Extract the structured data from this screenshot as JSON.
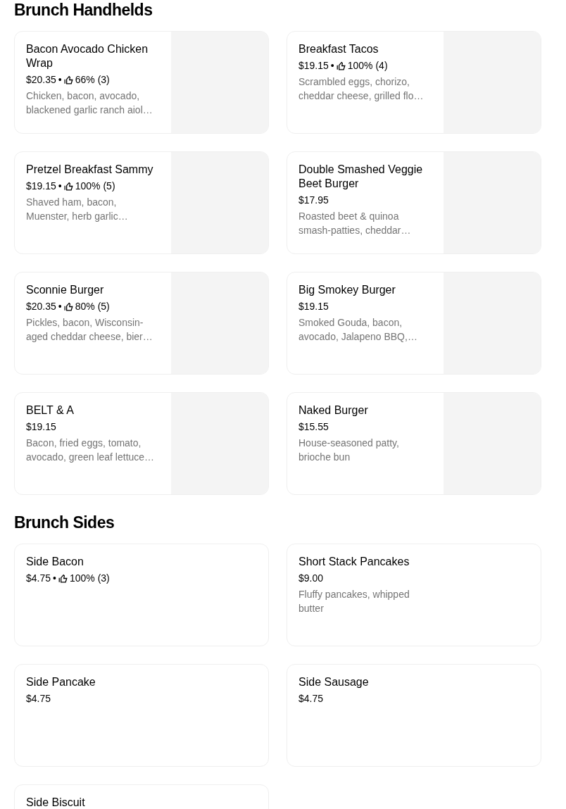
{
  "sections": [
    {
      "title": "Brunch Handhelds",
      "items": [
        {
          "name": "Bacon Avocado Chicken Wrap",
          "price": "$20.35",
          "separator": "•",
          "rating": "66% (3)",
          "description": "Chicken, bacon, avocado, blackened garlic ranch aiol…",
          "image": true
        },
        {
          "name": "Breakfast Tacos",
          "price": "$19.15",
          "separator": "•",
          "rating": "100% (4)",
          "description": "Scrambled eggs, chorizo, cheddar cheese, grilled flo…",
          "image": true
        },
        {
          "name": "Pretzel Breakfast Sammy",
          "price": "$19.15",
          "separator": "•",
          "rating": "100% (5)",
          "description": "Shaved ham, bacon, Muenster, herb garlic…",
          "image": true
        },
        {
          "name": "Double Smashed Veggie Beet Burger",
          "price": "$17.95",
          "description": "Roasted beet & quinoa smash-patties, cheddar…",
          "image": true
        },
        {
          "name": "Sconnie Burger",
          "price": "$20.35",
          "separator": "•",
          "rating": "80% (5)",
          "description": "Pickles, bacon, Wisconsin-aged cheddar cheese, bier…",
          "image": true
        },
        {
          "name": "Big Smokey Burger",
          "price": "$19.15",
          "description": "Smoked Gouda, bacon, avocado, Jalapeno BBQ,…",
          "image": true
        },
        {
          "name": "BELT & A",
          "price": "$19.15",
          "description": "Bacon, fried eggs, tomato, avocado, green leaf lettuce…",
          "image": true
        },
        {
          "name": "Naked Burger",
          "price": "$15.55",
          "description": "House-seasoned patty, brioche bun",
          "image": true
        }
      ]
    },
    {
      "title": "Brunch Sides",
      "items": [
        {
          "name": "Side Bacon",
          "price": "$4.75",
          "separator": "•",
          "rating": "100% (3)",
          "image": false
        },
        {
          "name": "Short Stack Pancakes",
          "price": "$9.00",
          "description": "Fluffy pancakes, whipped butter",
          "image": false
        },
        {
          "name": "Side Pancake",
          "price": "$4.75",
          "image": false
        },
        {
          "name": "Side Sausage",
          "price": "$4.75",
          "image": false
        },
        {
          "name": "Side Biscuit",
          "image": false
        }
      ]
    }
  ]
}
